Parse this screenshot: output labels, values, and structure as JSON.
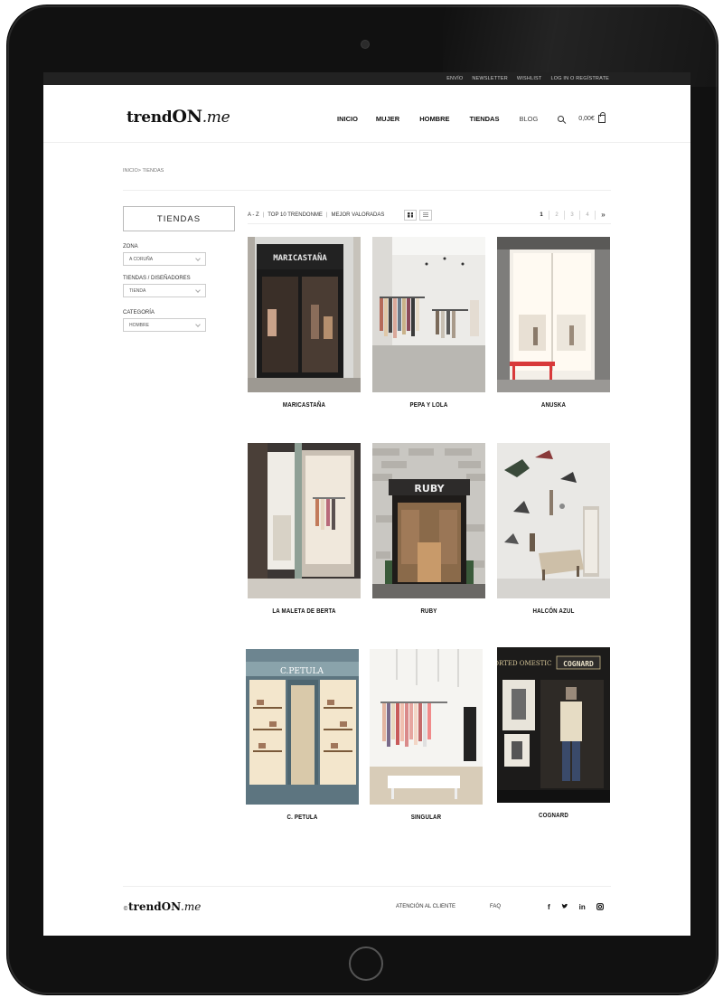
{
  "topbar": {
    "links": [
      "ENVÍO",
      "NEWSLETTER",
      "WISHLIST",
      "LOG IN O REGÍSTRATE"
    ]
  },
  "brand": {
    "logo_a": "trend",
    "logo_b": "ON",
    "logo_c": ".me"
  },
  "nav": {
    "items": [
      "INICIO",
      "MUJER",
      "HOMBRE",
      "TIENDAS",
      "BLOG"
    ],
    "cart_total": "0,00€"
  },
  "breadcrumb": "INICIO> TIENDAS",
  "sidebar": {
    "title": "TIENDAS",
    "filters": [
      {
        "label": "ZONA",
        "value": "A CORUÑA"
      },
      {
        "label": "TIENDAS / DISEÑADORES",
        "value": "TIENDA"
      },
      {
        "label": "CATEGORÍA",
        "value": "HOMBRE"
      }
    ]
  },
  "toolbar": {
    "sort": [
      "A - Z",
      "TOP 10 TRENDONME",
      "MEJOR VALORADAS"
    ],
    "pages": [
      "1",
      "2",
      "3",
      "4",
      "»"
    ]
  },
  "stores": [
    {
      "name": "MARICASTAÑA",
      "sign": "MARICASTAÑA"
    },
    {
      "name": "PEPA Y LOLA"
    },
    {
      "name": "ANUSKA"
    },
    {
      "name": "LA MALETA DE BERTA"
    },
    {
      "name": "RUBY",
      "sign": "RUBY"
    },
    {
      "name": "HALCÓN AZUL"
    },
    {
      "name": "C. PETULA",
      "sign": "C.PETULA"
    },
    {
      "name": "SINGULAR"
    },
    {
      "name": "COGNARD",
      "sign": "COGNARD",
      "sign2": "PORTED OMESTIC"
    }
  ],
  "footer": {
    "copy": "©",
    "links": [
      "ATENCIÓN AL CLIENTE",
      "FAQ"
    ],
    "social": [
      "f",
      "t",
      "in",
      "ig"
    ]
  }
}
